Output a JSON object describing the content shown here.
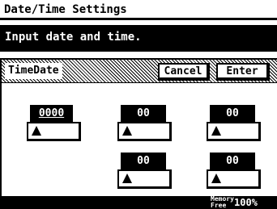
{
  "screen": {
    "title": "Date/Time Settings",
    "message": "Input date and time."
  },
  "tab": {
    "label": "TimeDate"
  },
  "buttons": {
    "cancel": "Cancel",
    "enter": "Enter"
  },
  "fields": {
    "year": "0000",
    "month": "00",
    "day": "00",
    "hour": "00",
    "minute": "00"
  },
  "status": {
    "memory_label": "Memory Free",
    "memory_value": "100%"
  },
  "icons": {
    "spinner": "triangle-up-icon"
  }
}
